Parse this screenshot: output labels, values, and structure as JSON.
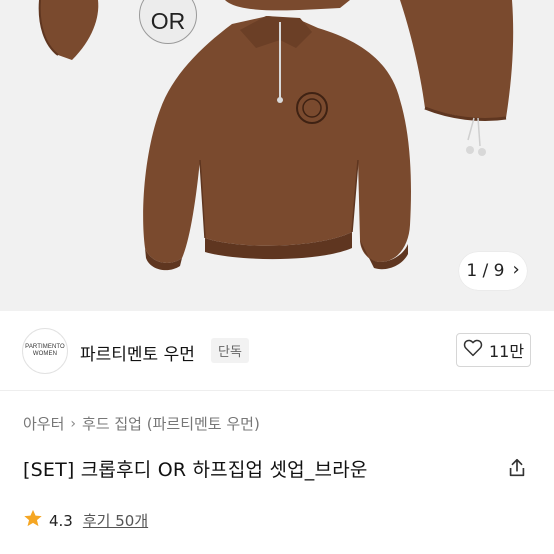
{
  "hero": {
    "badge_text": "OR",
    "pager_text": "1 / 9",
    "colors": {
      "background": "#f1f1f1",
      "garment": "#7a4a2e",
      "garment_dark": "#5f3620"
    }
  },
  "brand": {
    "logo_line1": "PARTIMENTO",
    "logo_line2": "WOMEN",
    "name": "파르티멘토 우먼",
    "badge": "단독",
    "like_count": "11만"
  },
  "breadcrumb": {
    "items": [
      "아우터",
      "후드 집업 (파르티멘토 우먼)"
    ],
    "separator": "›"
  },
  "product": {
    "title": "[SET] 크롭후디 OR 하프집업 셋업_브라운"
  },
  "rating": {
    "score": "4.3",
    "reviews": "후기 50개",
    "star_color": "#f5a623"
  },
  "icons": [
    "heart-icon",
    "share-icon",
    "star-icon",
    "chevron-right-icon"
  ]
}
